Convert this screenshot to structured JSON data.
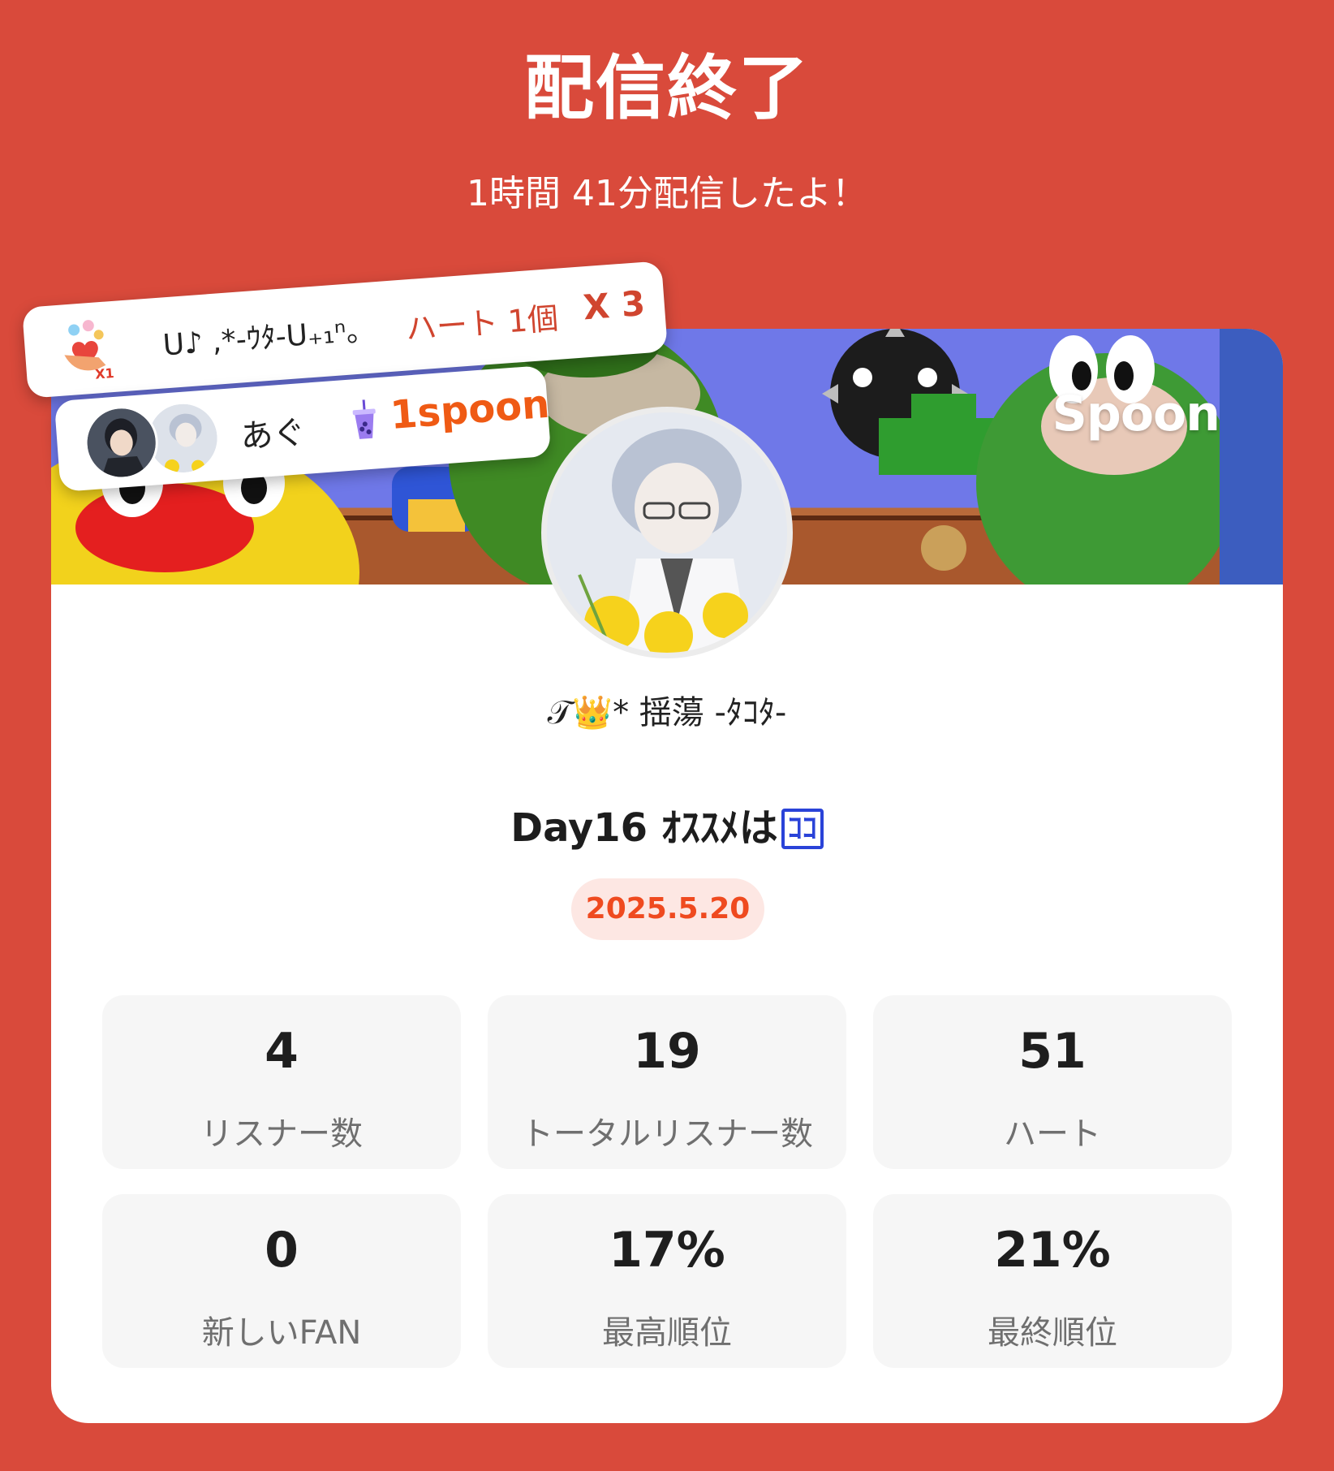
{
  "header": {
    "title": "配信終了",
    "subtitle": "1時間 41分配信したよ！"
  },
  "banner": {
    "brand": "Spoon"
  },
  "profile": {
    "username": "𝒯👑* 揺蕩 -ﾀｺﾀ-",
    "stream_title": "Day16 ｵｽｽﾒは",
    "stream_title_box": "ｺｺ",
    "date": "2025.5.20"
  },
  "stats": [
    {
      "value": "4",
      "label": "リスナー数"
    },
    {
      "value": "19",
      "label": "トータルリスナー数"
    },
    {
      "value": "51",
      "label": "ハート"
    },
    {
      "value": "0",
      "label": "新しいFAN"
    },
    {
      "value": "17%",
      "label": "最高順位"
    },
    {
      "value": "21%",
      "label": "最終順位"
    }
  ],
  "notifications": {
    "heart": {
      "icon": "heart-gift-icon",
      "name": "ᑌ♪ ,*-ｳﾀ-U₊₁ⁿ。",
      "item": "ハート 1個",
      "count": "X 3"
    },
    "spoon": {
      "name": "あぐ",
      "icon": "cup-icon",
      "amount": "1spoon"
    }
  },
  "colors": {
    "background": "#d94a3b",
    "accent_orange": "#ef5a14",
    "date_pill_bg": "#fde7e3"
  }
}
